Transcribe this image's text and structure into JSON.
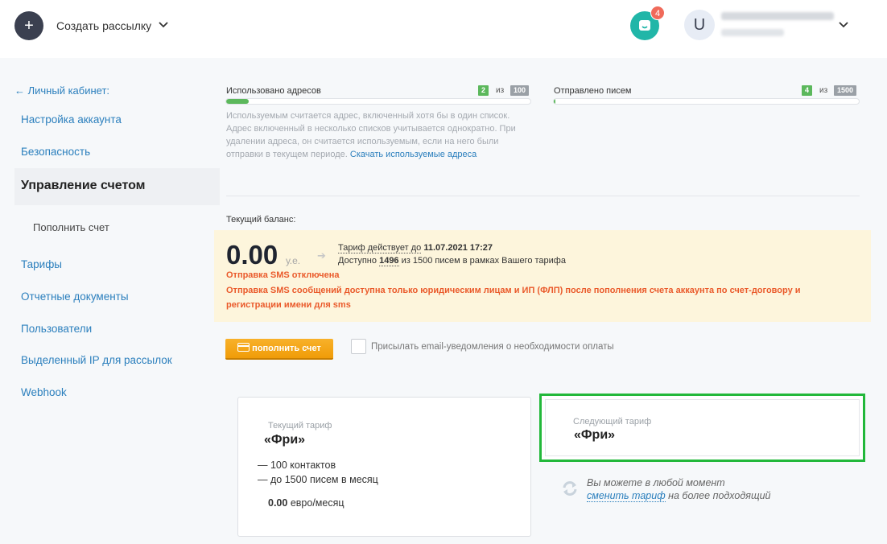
{
  "header": {
    "create_icon": "+",
    "create_label": "Создать рассылку",
    "chat_badge": "4",
    "avatar_letter": "U"
  },
  "sidebar": {
    "back_link": "← Личный кабинет:",
    "items": [
      {
        "label": "Настройка аккаунта"
      },
      {
        "label": "Безопасность"
      },
      {
        "label": "Управление счетом"
      },
      {
        "label": "Пополнить счет"
      },
      {
        "label": "Тарифы"
      },
      {
        "label": "Отчетные документы"
      },
      {
        "label": "Пользователи"
      },
      {
        "label": "Выделенный IP для рассылок"
      },
      {
        "label": "Webhook"
      }
    ]
  },
  "usage": {
    "addresses": {
      "label": "Использовано адресов",
      "used": "2",
      "of": "из",
      "total": "100",
      "fraction": 0.02
    },
    "emails": {
      "label": "Отправлено писем",
      "used": "4",
      "of": "из",
      "total": "1500",
      "fraction": 0.0027
    },
    "note": "Используемым считается адрес, включенный хотя бы в один список. Адрес включенный в несколько списков учитывается однократно. При удалении адреса, он считается используемым, если на него были отправки в текущем периоде.",
    "note_link": "Скачать используемые адреса"
  },
  "balance": {
    "label": "Текущий баланс:",
    "amount": "0.00",
    "unit": "у.е.",
    "arrow": "➔",
    "tariff_prefix": "Тариф действует до",
    "tariff_date": "11.07.2021 17:27",
    "available_prefix": "Доступно",
    "available_count": "1496",
    "available_suffix": "из 1500 писем в рамках Вашего тарифа",
    "sms_off": "Отправка SMS отключена",
    "sms_note": "Отправка SMS сообщений доступна только юридическим лицам и ИП (ФЛП) после пополнения счета аккаунта по счет-договору и регистрации имени для sms"
  },
  "actions": {
    "topup_label": "пополнить счет",
    "notify_label": "Присылать email-уведомления о необходимости оплаты"
  },
  "tariff": {
    "current": {
      "sub": "Текущий тариф",
      "name": "«Фри»",
      "features": [
        "— 100 контактов",
        "— до 1500 писем в месяц"
      ],
      "price_value": "0.00",
      "price_unit": "евро/месяц"
    },
    "next": {
      "sub": "Следующий тариф",
      "name": "«Фри»"
    },
    "change_prefix": "Вы можете в любой момент",
    "change_link": "сменить тариф",
    "change_suffix": "на более подходящий"
  },
  "colors": {
    "accent": "#2b7fbd",
    "success": "#5cb85c",
    "warning_text": "#ea5a2b",
    "topup_button": "#f5a81a",
    "highlight_border": "#22b83a"
  },
  "icons": [
    "plus-icon",
    "chevron-down-icon",
    "chat-icon",
    "credit-card-icon",
    "refresh-icon"
  ]
}
